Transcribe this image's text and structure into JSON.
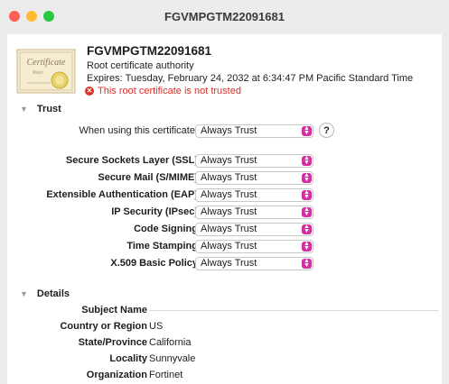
{
  "window": {
    "title": "FGVMPGTM22091681"
  },
  "header": {
    "cert_name": "FGVMPGTM22091681",
    "cert_type": "Root certificate authority",
    "expires": "Expires: Tuesday, February 24, 2032 at 6:34:47 PM Pacific Standard Time",
    "warning": "This root certificate is not trusted",
    "icon_script": "Certificate",
    "icon_sub": "Root"
  },
  "trust": {
    "heading": "Trust",
    "when_label": "When using this certificate:",
    "when_value": "Always Trust",
    "help_label": "?",
    "rows": [
      {
        "label": "Secure Sockets Layer (SSL)",
        "value": "Always Trust"
      },
      {
        "label": "Secure Mail (S/MIME)",
        "value": "Always Trust"
      },
      {
        "label": "Extensible Authentication (EAP)",
        "value": "Always Trust"
      },
      {
        "label": "IP Security (IPsec)",
        "value": "Always Trust"
      },
      {
        "label": "Code Signing",
        "value": "Always Trust"
      },
      {
        "label": "Time Stamping",
        "value": "Always Trust"
      },
      {
        "label": "X.509 Basic Policy",
        "value": "Always Trust"
      }
    ]
  },
  "details": {
    "heading": "Details",
    "subject_label": "Subject Name",
    "rows": [
      {
        "label": "Country or Region",
        "value": "US"
      },
      {
        "label": "State/Province",
        "value": "California"
      },
      {
        "label": "Locality",
        "value": "Sunnyvale"
      },
      {
        "label": "Organization",
        "value": "Fortinet"
      }
    ]
  },
  "colors": {
    "warning": "#d8302b",
    "popup_accent": "#d42fa0"
  },
  "icons": {
    "chevron": "chevron-down-icon",
    "popup": "popup-arrows-icon",
    "error": "x-circle-icon"
  }
}
